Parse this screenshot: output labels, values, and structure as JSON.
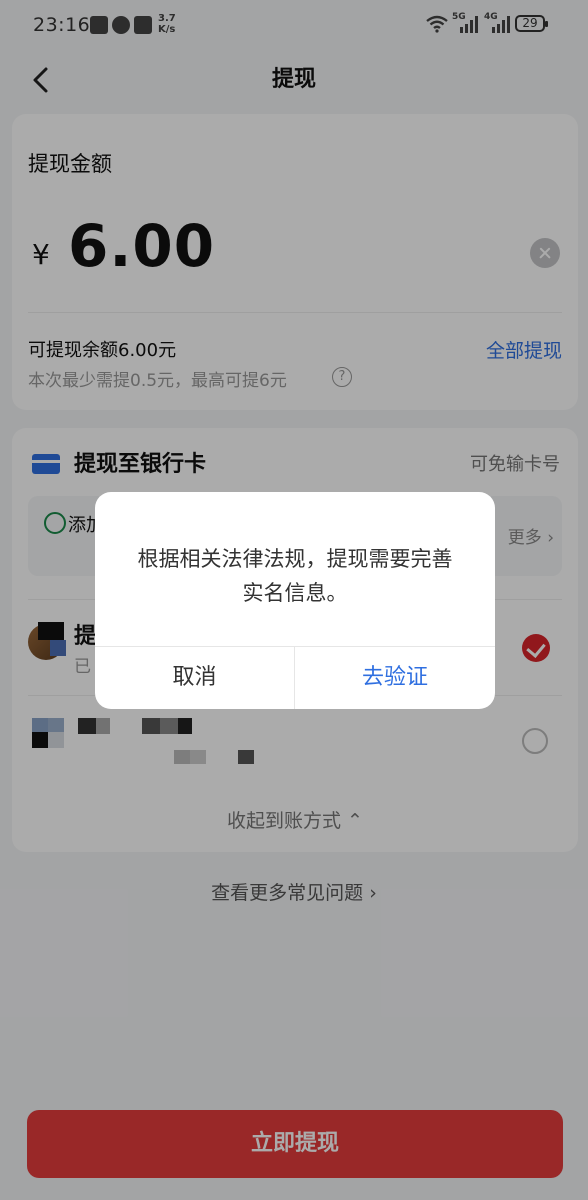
{
  "status_bar": {
    "time": "23:16",
    "net_speed_value": "3.7",
    "net_speed_unit": "K/s",
    "battery": "29",
    "network_5g": "5G",
    "network_4g": "4G"
  },
  "header": {
    "title": "提现"
  },
  "amount": {
    "label": "提现金额",
    "currency": "¥",
    "value": "6.00",
    "balance_text": "可提现余额6.00元",
    "withdraw_all": "全部提现",
    "limit_text": "本次最少需提0.5元，最高可提6元",
    "help_symbol": "?"
  },
  "bank": {
    "title": "提现至银行卡",
    "no_card_number": "可免输卡号",
    "add_card_label": "添加",
    "more": "更多 ›",
    "account_1_name": "提",
    "account_1_sub": "已",
    "collapse": "收起到账方式 ⌃"
  },
  "faq": "查看更多常见问题 ›",
  "submit_button": "立即提现",
  "dialog": {
    "message": "根据相关法律法规，提现需要完善实名信息。",
    "cancel": "取消",
    "confirm": "去验证"
  },
  "colors": {
    "accent_blue": "#2f6fe0",
    "primary_red": "#e53d3d"
  }
}
